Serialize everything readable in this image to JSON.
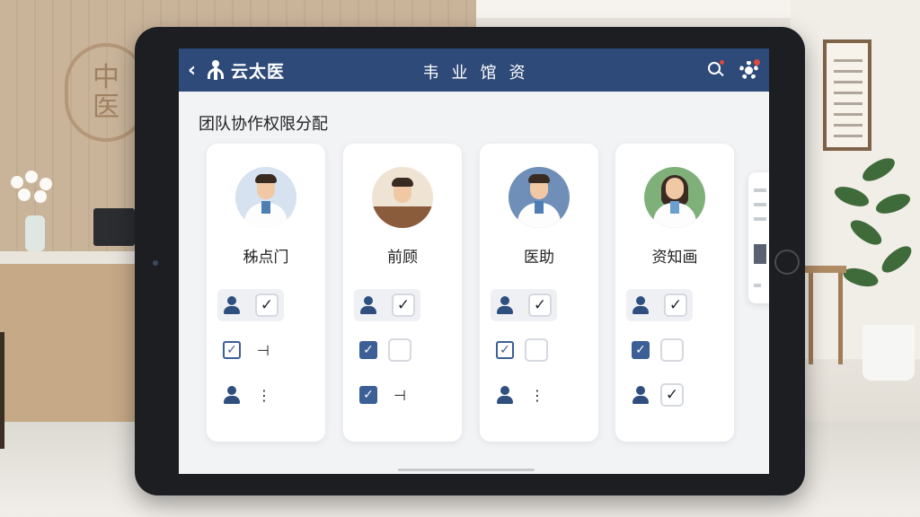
{
  "app": {
    "brand": "云太医",
    "center_title": "韦业馆资"
  },
  "section_title": "团队协作权限分配",
  "cards": [
    {
      "name": "秭点门",
      "rows": [
        {
          "glyph": "✓"
        },
        {
          "glyph": "⊣"
        },
        {
          "glyph": "⋮"
        }
      ]
    },
    {
      "name": "前顾",
      "rows": [
        {
          "glyph": "✓"
        },
        {
          "glyph": ""
        },
        {
          "glyph": "⊣"
        }
      ]
    },
    {
      "name": "医助",
      "rows": [
        {
          "glyph": "✓"
        },
        {
          "glyph": ""
        },
        {
          "glyph": "⋮"
        }
      ]
    },
    {
      "name": "资知画",
      "rows": [
        {
          "glyph": "✓"
        },
        {
          "glyph": ""
        },
        {
          "glyph": "✓"
        }
      ]
    }
  ],
  "background_sign": [
    "中",
    "医"
  ],
  "colors": {
    "appbar": "#2e4a78",
    "accent": "#3c5f95",
    "badge": "#e0483f"
  },
  "icons": [
    "back-icon",
    "brand-logo-icon",
    "search-icon",
    "gear-icon",
    "person-icon",
    "checkbox-icon"
  ]
}
